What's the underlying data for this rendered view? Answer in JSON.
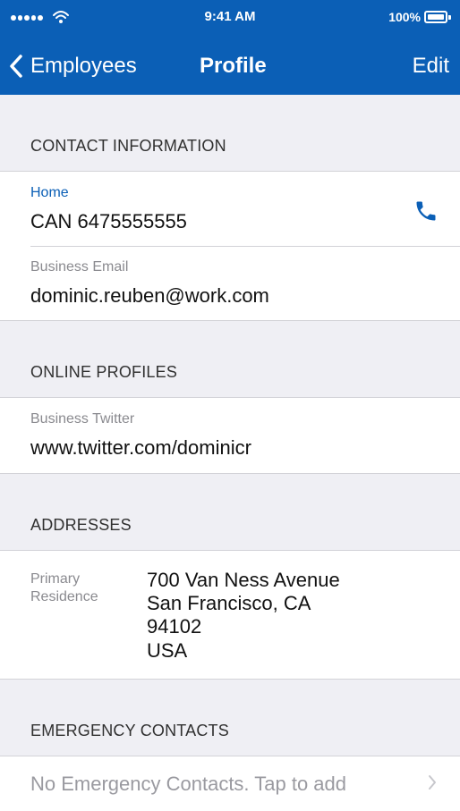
{
  "status_bar": {
    "time": "9:41 AM",
    "battery": "100%",
    "icons": [
      "signal-icon",
      "wifi-icon",
      "battery-icon"
    ]
  },
  "nav": {
    "back_label": "Employees",
    "title": "Profile",
    "edit_label": "Edit",
    "icons": [
      "back-chevron-icon"
    ]
  },
  "sections": {
    "contact": {
      "title": "CONTACT INFORMATION",
      "home_label": "Home",
      "home_value": "CAN 6475555555",
      "business_email_label": "Business Email",
      "business_email_value": "dominic.reuben@work.com",
      "icons": [
        "phone-icon"
      ]
    },
    "online": {
      "title": "ONLINE PROFILES",
      "twitter_label": "Business Twitter",
      "twitter_value": "www.twitter.com/dominicr"
    },
    "addresses": {
      "title": "ADDRESSES",
      "primary_label_line1": "Primary",
      "primary_label_line2": "Residence",
      "address_line1": "700 Van Ness Avenue",
      "address_line2": "San Francisco, CA",
      "address_line3": "94102",
      "address_line4": "USA"
    },
    "emergency": {
      "title": "EMERGENCY CONTACTS",
      "empty_text": "No Emergency Contacts. Tap to add",
      "icons": [
        "chevron-right-icon"
      ]
    }
  },
  "colors": {
    "nav_blue": "#0b5fb6",
    "background": "#efeff4",
    "separator": "#d2d2d7",
    "label_gray": "#8a8a8f",
    "text": "#111111"
  }
}
